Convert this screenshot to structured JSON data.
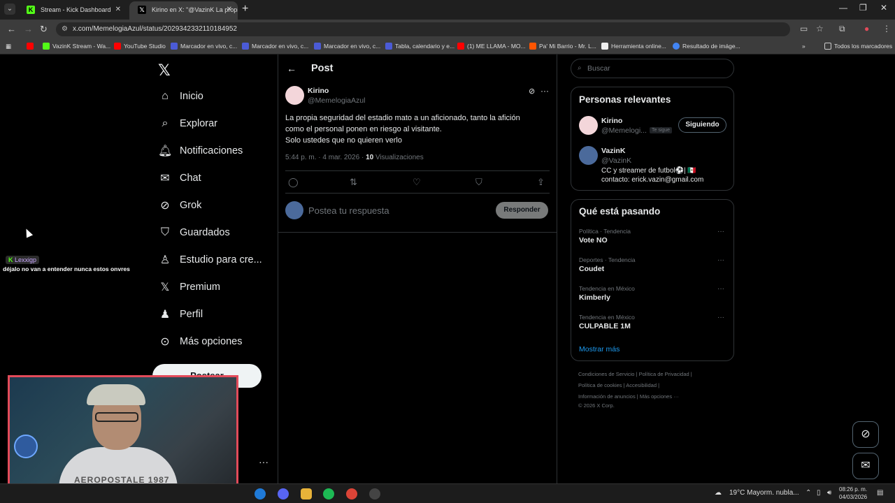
{
  "browser": {
    "tabs": [
      {
        "label": "Stream - Kick Dashboard",
        "favicon": "kick-icon"
      },
      {
        "label": "Kirino en X: \"@VazinK La propia",
        "favicon": "x-icon"
      }
    ],
    "url": "x.com/MemelogiaAzul/status/2029342332110184952",
    "bookmarks": [
      "VazinK Stream - Wa...",
      "YouTube Studio",
      "Marcador en vivo, c...",
      "Marcador en vivo, c...",
      "Marcador en vivo, c...",
      "Tabla, calendario y e...",
      "(1) ME LLAMA - MO...",
      "Pa' Mi Barrio - Mr. L...",
      "Herramienta online...",
      "Resultado de imáge..."
    ],
    "all_bookmarks": "Todos los marcadores"
  },
  "sidebar": {
    "items": [
      {
        "label": "Inicio",
        "icon": "home-icon"
      },
      {
        "label": "Explorar",
        "icon": "search-icon"
      },
      {
        "label": "Notificaciones",
        "icon": "bell-icon"
      },
      {
        "label": "Chat",
        "icon": "mail-icon"
      },
      {
        "label": "Grok",
        "icon": "grok-icon"
      },
      {
        "label": "Guardados",
        "icon": "bookmark-icon"
      },
      {
        "label": "Estudio para cre...",
        "icon": "studio-icon"
      },
      {
        "label": "Premium",
        "icon": "x-icon"
      },
      {
        "label": "Perfil",
        "icon": "person-icon"
      },
      {
        "label": "Más opciones",
        "icon": "more-icon"
      }
    ],
    "post_button": "Postear"
  },
  "post": {
    "header": "Post",
    "author_name": "Kirino",
    "author_handle": "@MemelogiaAzul",
    "text_lines": [
      "La propia seguridad del estadio mato a un aficionado, tanto la afición",
      "como el personal ponen en riesgo al visitante.",
      "Solo ustedes que no quieren verlo"
    ],
    "time": "5:44 p. m. · 4 mar. 2026 · ",
    "views_count": "10",
    "views_label": " Visualizaciones",
    "reply_placeholder": "Postea tu respuesta",
    "reply_button": "Responder"
  },
  "right": {
    "search_placeholder": "Buscar",
    "relevant_title": "Personas relevantes",
    "people": [
      {
        "name": "Kirino",
        "handle": "@Memelogi...",
        "badge": "Te sigue",
        "button": "Siguiendo"
      },
      {
        "name": "VazinK",
        "handle": "@VazinK",
        "bio1": "CC y streamer de futbol⚽| 🇲🇽",
        "bio2": "contacto: erick.vazin@gmail.com"
      }
    ],
    "trending_title": "Qué está pasando",
    "trends": [
      {
        "category": "Política · Tendencia",
        "name": "Vote NO"
      },
      {
        "category": "Deportes · Tendencia",
        "name": "Coudet"
      },
      {
        "category": "Tendencia en México",
        "name": "Kimberly"
      },
      {
        "category": "Tendencia en México",
        "name": "CULPABLE 1M"
      }
    ],
    "show_more": "Mostrar más",
    "footer": {
      "line1": "Condiciones de Servicio  |  Política de Privacidad  |",
      "line2": "Política de cookies  |  Accesibilidad  |",
      "line3": "Información de anuncios  |  Más opciones ···",
      "line4": "© 2026 X Corp."
    }
  },
  "overlay": {
    "chat_user": "Lexxigp",
    "chat_message": "déjalo no van a entender nunca estos onvres",
    "shirt_text": "AEROPOSTALE 1987"
  },
  "taskbar": {
    "weather": "19°C  Mayorm. nubla...",
    "time": "08:26 p. m.",
    "date": "04/03/2026"
  }
}
